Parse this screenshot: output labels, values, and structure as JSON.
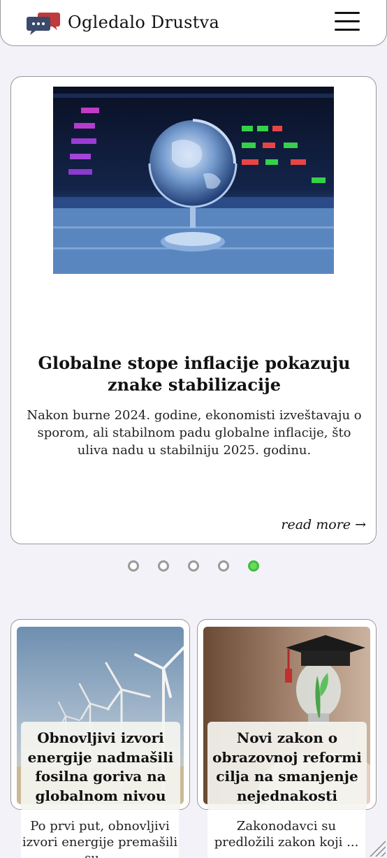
{
  "header": {
    "brand": "Ogledalo Drustva",
    "logo_icon": "chat-bubbles-icon",
    "menu_icon": "hamburger-menu-icon"
  },
  "hero": {
    "title": "Globalne stope inflacije pokazuju znake stabilizacije",
    "text": "Nakon burne 2024. godine, ekonomisti izveštavaju o sporom, ali stabilnom padu globalne inflacije, što uliva nadu u stabilniju 2025. godinu.",
    "read_more": "read more →",
    "image": "glass-globe-stock-chart-image"
  },
  "carousel": {
    "slides": 5,
    "active": 5
  },
  "cards": [
    {
      "title": "Obnovljivi izvori energije nadmašili fosilna goriva na globalnom nivou",
      "text": "Po prvi put, obnovljivi izvori energije premašili su ...",
      "image": "wind-turbines-image"
    },
    {
      "title": "Novi zakon o obrazovnoj reformi cilja na smanjenje nejednakosti",
      "text": "Zakonodavci su predložili zakon koji ...",
      "image": "graduation-cap-lightbulb-image"
    }
  ],
  "colors": {
    "background": "#f3f2f8",
    "dot_active": "#66dd55",
    "dot_inactive": "#9a9a9a"
  }
}
